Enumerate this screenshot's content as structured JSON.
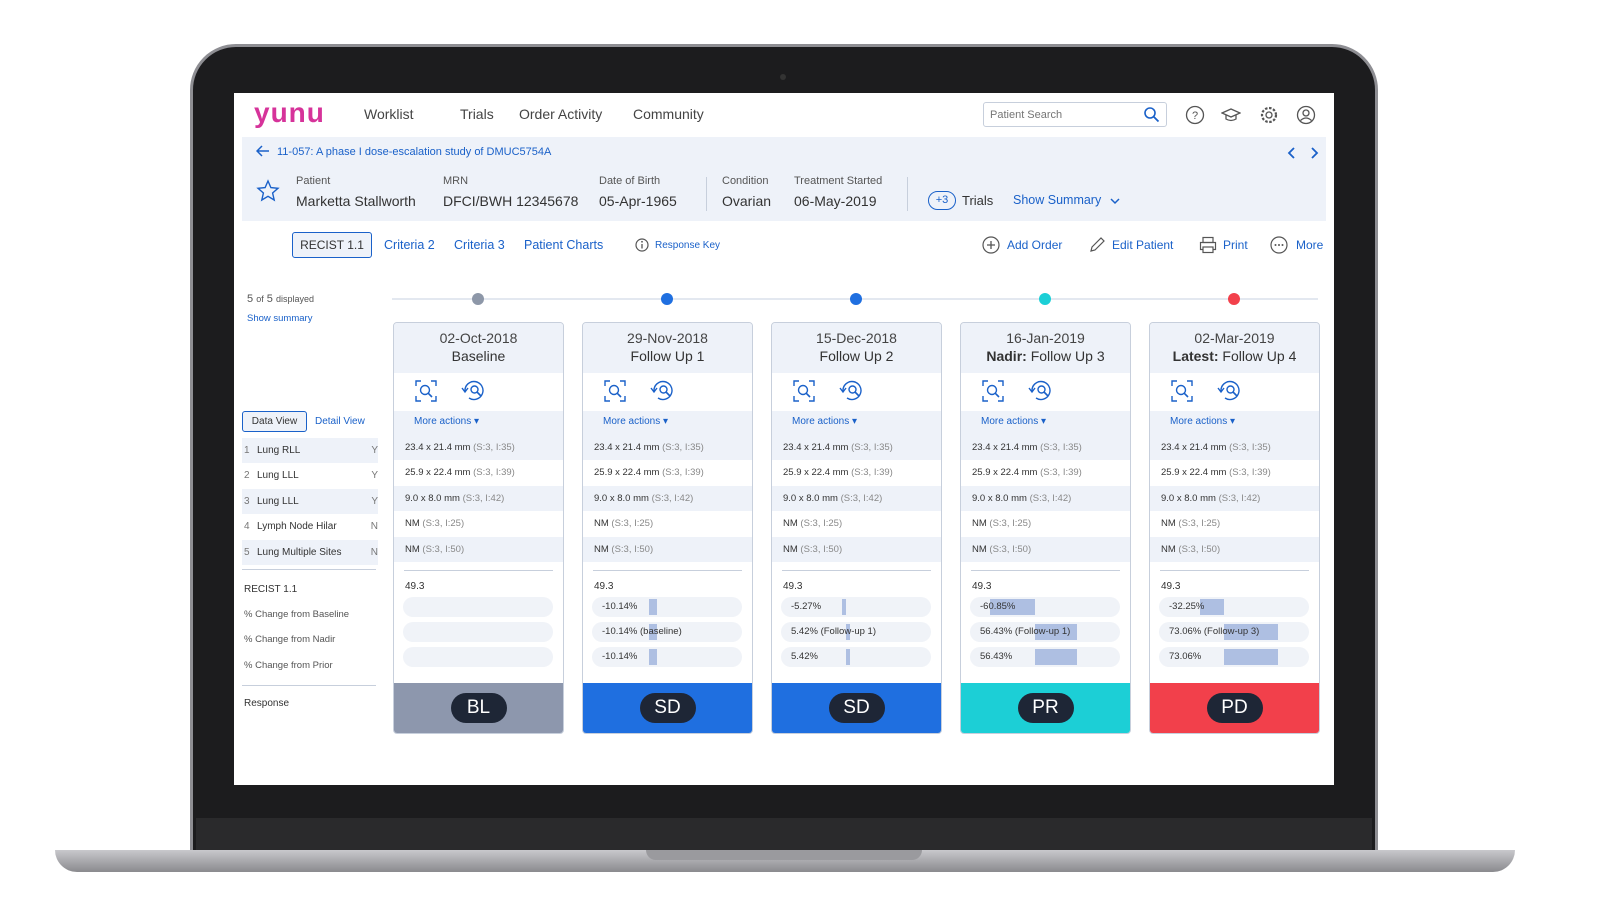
{
  "app": {
    "logo": "yunu",
    "nav": [
      "Worklist",
      "Trials",
      "Order Activity",
      "Community"
    ],
    "search_placeholder": "Patient Search"
  },
  "study": {
    "title": "11-057: A phase I dose-escalation study of DMUC5754A"
  },
  "patient": {
    "labels": {
      "patient": "Patient",
      "mrn": "MRN",
      "dob": "Date of Birth",
      "condition": "Condition",
      "treatment": "Treatment Started"
    },
    "name": "Marketta Stallworth",
    "mrn": "DFCI/BWH 12345678",
    "dob": "05-Apr-1965",
    "condition": "Ovarian",
    "treatment_started": "06-May-2019",
    "trials_badge": "+3",
    "trials_label": "Trials",
    "show_summary": "Show Summary"
  },
  "tabs": {
    "items": [
      "RECIST 1.1",
      "Criteria 2",
      "Criteria 3",
      "Patient Charts"
    ],
    "response_key": "Response Key"
  },
  "actions": [
    "Add Order",
    "Edit Patient",
    "Print",
    "More"
  ],
  "left": {
    "count_a": "5",
    "count_of": "of",
    "count_b": "5",
    "displayed": "displayed",
    "show_summary": "Show summary",
    "data_view": "Data View",
    "detail_view": "Detail View",
    "lesions": [
      {
        "n": "1",
        "name": "Lung RLL",
        "flag": "Y"
      },
      {
        "n": "2",
        "name": "Lung LLL",
        "flag": "Y"
      },
      {
        "n": "3",
        "name": "Lung LLL",
        "flag": "Y"
      },
      {
        "n": "4",
        "name": "Lymph Node Hilar",
        "flag": "N"
      },
      {
        "n": "5",
        "name": "Lung Multiple Sites",
        "flag": "N"
      }
    ],
    "recist": "RECIST 1.1",
    "metrics": [
      "% Change from Baseline",
      "% Change from Nadir",
      "% Change from Prior"
    ],
    "response": "Response"
  },
  "more_actions_label": "More actions ▾",
  "timepoints": [
    {
      "date": "02-Oct-2018",
      "prefix": "",
      "title": "Baseline",
      "dot_color": "#8d97a8",
      "measurements": [
        {
          "v": "23.4 x 21.4 mm",
          "s": "(S:3, I:35)"
        },
        {
          "v": "25.9 x 22.4 mm",
          "s": "(S:3, I:39)"
        },
        {
          "v": "9.0 x 8.0 mm",
          "s": "(S:3, I:42)"
        },
        {
          "v": "NM",
          "s": "(S:3, I:25)"
        },
        {
          "v": "NM",
          "s": "(S:3, I:50)"
        }
      ],
      "sum": "49.3",
      "changes": [
        {
          "label": "",
          "value": null
        },
        {
          "label": "",
          "value": null
        },
        {
          "label": "",
          "value": null
        }
      ],
      "response": "BL",
      "response_color": "#8d97ad"
    },
    {
      "date": "29-Nov-2018",
      "prefix": "",
      "title": "Follow Up 1",
      "dot_color": "#1f6fe0",
      "measurements": [
        {
          "v": "23.4 x 21.4 mm",
          "s": "(S:3, I:35)"
        },
        {
          "v": "25.9 x 22.4 mm",
          "s": "(S:3, I:39)"
        },
        {
          "v": "9.0 x 8.0 mm",
          "s": "(S:3, I:42)"
        },
        {
          "v": "NM",
          "s": "(S:3, I:25)"
        },
        {
          "v": "NM",
          "s": "(S:3, I:50)"
        }
      ],
      "sum": "49.3",
      "changes": [
        {
          "label": "-10.14%",
          "value": -10.14
        },
        {
          "label": "-10.14% (baseline)",
          "value": -10.14
        },
        {
          "label": "-10.14%",
          "value": -10.14
        }
      ],
      "response": "SD",
      "response_color": "#1f6fe0"
    },
    {
      "date": "15-Dec-2018",
      "prefix": "",
      "title": "Follow Up 2",
      "dot_color": "#1f6fe0",
      "measurements": [
        {
          "v": "23.4 x 21.4 mm",
          "s": "(S:3, I:35)"
        },
        {
          "v": "25.9 x 22.4 mm",
          "s": "(S:3, I:39)"
        },
        {
          "v": "9.0 x 8.0 mm",
          "s": "(S:3, I:42)"
        },
        {
          "v": "NM",
          "s": "(S:3, I:25)"
        },
        {
          "v": "NM",
          "s": "(S:3, I:50)"
        }
      ],
      "sum": "49.3",
      "changes": [
        {
          "label": "-5.27%",
          "value": -5.27
        },
        {
          "label": "5.42% (Follow-up 1)",
          "value": 5.42
        },
        {
          "label": "5.42%",
          "value": 5.42
        }
      ],
      "response": "SD",
      "response_color": "#1f6fe0"
    },
    {
      "date": "16-Jan-2019",
      "prefix": "Nadir:",
      "title": " Follow Up 3",
      "dot_color": "#1ccfd6",
      "measurements": [
        {
          "v": "23.4 x 21.4 mm",
          "s": "(S:3, I:35)"
        },
        {
          "v": "25.9 x 22.4 mm",
          "s": "(S:3, I:39)"
        },
        {
          "v": "9.0 x 8.0 mm",
          "s": "(S:3, I:42)"
        },
        {
          "v": "NM",
          "s": "(S:3, I:25)"
        },
        {
          "v": "NM",
          "s": "(S:3, I:50)"
        }
      ],
      "sum": "49.3",
      "changes": [
        {
          "label": "-60.85%",
          "value": -60.85
        },
        {
          "label": "56.43% (Follow-up 1)",
          "value": 56.43
        },
        {
          "label": "56.43%",
          "value": 56.43
        }
      ],
      "response": "PR",
      "response_color": "#1ccfd6"
    },
    {
      "date": "02-Mar-2019",
      "prefix": "Latest:",
      "title": " Follow Up 4",
      "dot_color": "#f2404b",
      "measurements": [
        {
          "v": "23.4 x 21.4 mm",
          "s": "(S:3, I:35)"
        },
        {
          "v": "25.9 x 22.4 mm",
          "s": "(S:3, I:39)"
        },
        {
          "v": "9.0 x 8.0 mm",
          "s": "(S:3, I:42)"
        },
        {
          "v": "NM",
          "s": "(S:3, I:25)"
        },
        {
          "v": "NM",
          "s": "(S:3, I:50)"
        }
      ],
      "sum": "49.3",
      "changes": [
        {
          "label": "-32.25%",
          "value": -32.25
        },
        {
          "label": "73.06% (Follow-up 3)",
          "value": 73.06
        },
        {
          "label": "73.06%",
          "value": 73.06
        }
      ],
      "response": "PD",
      "response_color": "#f2404b"
    }
  ],
  "colors": {
    "accent": "#1a61c9",
    "brand": "#d6339a",
    "header_bg": "#eef2f9"
  }
}
